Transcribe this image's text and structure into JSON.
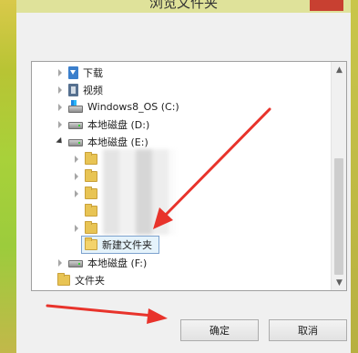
{
  "window": {
    "title": "浏览文件夹"
  },
  "tree": {
    "items": [
      {
        "label": "下载",
        "icon": "download-folder-icon",
        "expander": "collapsed"
      },
      {
        "label": "视频",
        "icon": "video-folder-icon",
        "expander": "collapsed"
      },
      {
        "label": "Windows8_OS (C:)",
        "icon": "windows-drive-icon",
        "expander": "collapsed"
      },
      {
        "label": "本地磁盘 (D:)",
        "icon": "drive-icon",
        "expander": "collapsed"
      },
      {
        "label": "本地磁盘 (E:)",
        "icon": "drive-icon",
        "expander": "expanded"
      },
      {
        "label": "",
        "icon": "folder-icon",
        "expander": "collapsed"
      },
      {
        "label": "",
        "icon": "folder-icon",
        "expander": "collapsed"
      },
      {
        "label": "",
        "icon": "folder-icon",
        "expander": "collapsed"
      },
      {
        "label": "",
        "icon": "folder-icon",
        "expander": "none"
      },
      {
        "label": "",
        "icon": "folder-icon",
        "expander": "collapsed"
      },
      {
        "label": "新建文件夹",
        "icon": "folder-icon",
        "expander": "none",
        "selected": true
      },
      {
        "label": "本地磁盘 (F:)",
        "icon": "drive-icon",
        "expander": "collapsed"
      },
      {
        "label": "文件夹",
        "icon": "folder-icon",
        "expander": "none"
      }
    ]
  },
  "buttons": {
    "ok_label": "确定",
    "cancel_label": "取消"
  },
  "colors": {
    "selection": "#e5f3fb",
    "selection_border": "#7da2ce",
    "arrow": "#e8332b"
  }
}
